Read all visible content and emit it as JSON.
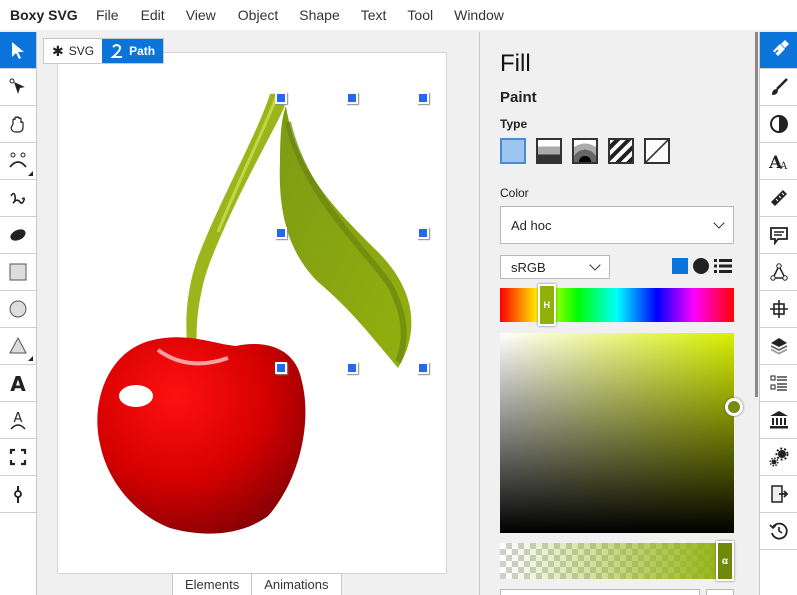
{
  "app": {
    "title": "Boxy SVG",
    "menu": [
      "File",
      "Edit",
      "View",
      "Object",
      "Shape",
      "Text",
      "Tool",
      "Window"
    ]
  },
  "left_toolbar": {
    "tools": [
      {
        "name": "select-tool",
        "icon": "arrow-pointer-icon",
        "active": true
      },
      {
        "name": "edit-tool",
        "icon": "node-pointer-icon",
        "active": false
      },
      {
        "name": "pan-tool",
        "icon": "hand-icon",
        "active": false
      },
      {
        "name": "bezier-tool",
        "icon": "bezier-pen-icon",
        "active": false,
        "submenu": true
      },
      {
        "name": "freehand-tool",
        "icon": "freehand-icon",
        "active": false
      },
      {
        "name": "blob-tool",
        "icon": "blob-icon",
        "active": false
      },
      {
        "name": "rectangle-tool",
        "icon": "rectangle-icon",
        "active": false
      },
      {
        "name": "ellipse-tool",
        "icon": "ellipse-icon",
        "active": false
      },
      {
        "name": "triangle-tool",
        "icon": "triangle-icon",
        "active": false,
        "submenu": true
      },
      {
        "name": "text-tool",
        "icon": "text-icon",
        "active": false
      },
      {
        "name": "text-path-tool",
        "icon": "text-on-path-icon",
        "active": false
      },
      {
        "name": "crop-tool",
        "icon": "frame-icon",
        "active": false
      },
      {
        "name": "gradient-tool",
        "icon": "gradient-handle-icon",
        "active": false
      }
    ]
  },
  "canvas": {
    "breadcrumb": [
      {
        "label": "SVG",
        "icon": "asterisk-icon",
        "active": false
      },
      {
        "label": "Path",
        "icon": "path-icon",
        "active": true
      }
    ],
    "bottom_tabs": [
      "Elements",
      "Animations"
    ]
  },
  "fill_panel": {
    "title": "Fill",
    "section": "Paint",
    "type_label": "Type",
    "types": [
      {
        "name": "solid-color",
        "selected": true
      },
      {
        "name": "linear-gradient",
        "selected": false
      },
      {
        "name": "radial-gradient",
        "selected": false
      },
      {
        "name": "pattern",
        "selected": false
      },
      {
        "name": "none",
        "selected": false
      }
    ],
    "color_label": "Color",
    "color_source": "Ad hoc",
    "color_space": "sRGB",
    "view_modes": [
      "square-mode-icon",
      "circle-mode-icon",
      "list-mode-icon"
    ],
    "accent_color": "#0a74da",
    "hue_label": "H",
    "hue_position": 0.2,
    "saturation": 1.0,
    "brightness": 0.63,
    "alpha_label": "α",
    "alpha": 1.0,
    "current_color": "#8fb10a"
  },
  "right_toolbar": {
    "panels": [
      {
        "name": "fill-panel",
        "icon": "paint-bucket-icon",
        "active": true
      },
      {
        "name": "stroke-panel",
        "icon": "brush-icon",
        "active": false
      },
      {
        "name": "compositing-panel",
        "icon": "contrast-icon",
        "active": false
      },
      {
        "name": "typography-panel",
        "icon": "font-icon",
        "active": false
      },
      {
        "name": "geometry-panel",
        "icon": "ruler-icon",
        "active": false
      },
      {
        "name": "comment-panel",
        "icon": "comment-icon",
        "active": false
      },
      {
        "name": "transform-panel",
        "icon": "triangle-nodes-icon",
        "active": false
      },
      {
        "name": "arrange-panel",
        "icon": "crosshair-grid-icon",
        "active": false
      },
      {
        "name": "layers-panel",
        "icon": "layers-icon",
        "active": false
      },
      {
        "name": "elements-panel",
        "icon": "list-icon",
        "active": false
      },
      {
        "name": "library-panel",
        "icon": "library-icon",
        "active": false
      },
      {
        "name": "defs-panel",
        "icon": "gears-icon",
        "active": false
      },
      {
        "name": "export-panel",
        "icon": "export-icon",
        "active": false
      },
      {
        "name": "history-panel",
        "icon": "history-icon",
        "active": false
      }
    ]
  }
}
